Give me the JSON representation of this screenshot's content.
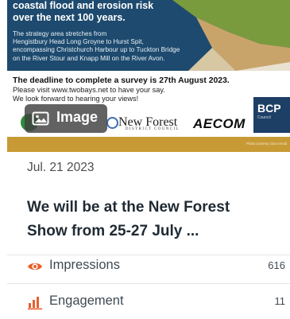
{
  "banner": {
    "headline_line1": "coastal flood and erosion risk",
    "headline_line2": "over the next 100 years.",
    "sub_line1": "The strategy area stretches from",
    "sub_line2": "Hengistbury Head Long Groyne to Hurst Spit,",
    "sub_line3": "encompassing Christchurch Harbour up to Tuckton Bridge",
    "sub_line4": "on the River Stour and Knapp Mill on the River Avon.",
    "deadline": "The deadline to complete a survey is 27th August 2023.",
    "visit_line1": "Please visit www.twobays.net to have your say.",
    "visit_line2": "We look forward to hearing your views!",
    "logo_new_forest": "New Forest",
    "logo_new_forest_sub": "DISTRICT COUNCIL",
    "logo_aecom": "AECOM",
    "logo_bcp": "BCP",
    "logo_bcp_sub": "Council",
    "photo_credit": "Photo courtesy: Dan Arnold"
  },
  "image_badge": {
    "label": "Image",
    "icon": "image-icon"
  },
  "post": {
    "date": "Jul. 21 2023",
    "title_line1": "We will be at the New Forest",
    "title_line2": "Show from 25-27 July ..."
  },
  "metrics": [
    {
      "label": "Impressions",
      "value": "616",
      "icon": "eye-icon",
      "color": "#e8602c"
    },
    {
      "label": "Engagement",
      "value": "11",
      "icon": "bar-chart-icon",
      "color": "#e8602c"
    }
  ],
  "colors": {
    "accent": "#e8602c",
    "banner_blue": "#1d4a6e",
    "strip_gold": "#c79a35"
  }
}
